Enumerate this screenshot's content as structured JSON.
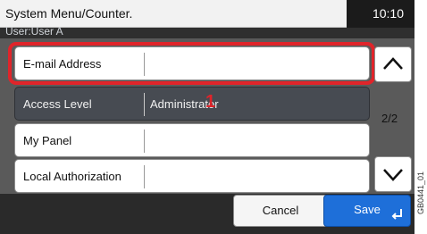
{
  "header": {
    "title": "System Menu/Counter.",
    "time": "10:10",
    "user": "User:User A"
  },
  "rows": [
    {
      "label": "E-mail Address",
      "value": ""
    },
    {
      "label": "Access Level",
      "value": "Administrator"
    },
    {
      "label": "My Panel",
      "value": ""
    },
    {
      "label": "Local Authorization",
      "value": ""
    }
  ],
  "annotation": {
    "callout": "1"
  },
  "pager": {
    "indicator": "2/2",
    "up_icon": "chevron-up-icon",
    "down_icon": "chevron-down-icon"
  },
  "footer": {
    "cancel_label": "Cancel",
    "save_label": "Save",
    "enter_icon": "enter-icon"
  },
  "reference_code": "GB0441_01",
  "colors": {
    "highlight": "#e0242a",
    "save_button": "#1e6fd9",
    "selected_row": "#474b52"
  }
}
